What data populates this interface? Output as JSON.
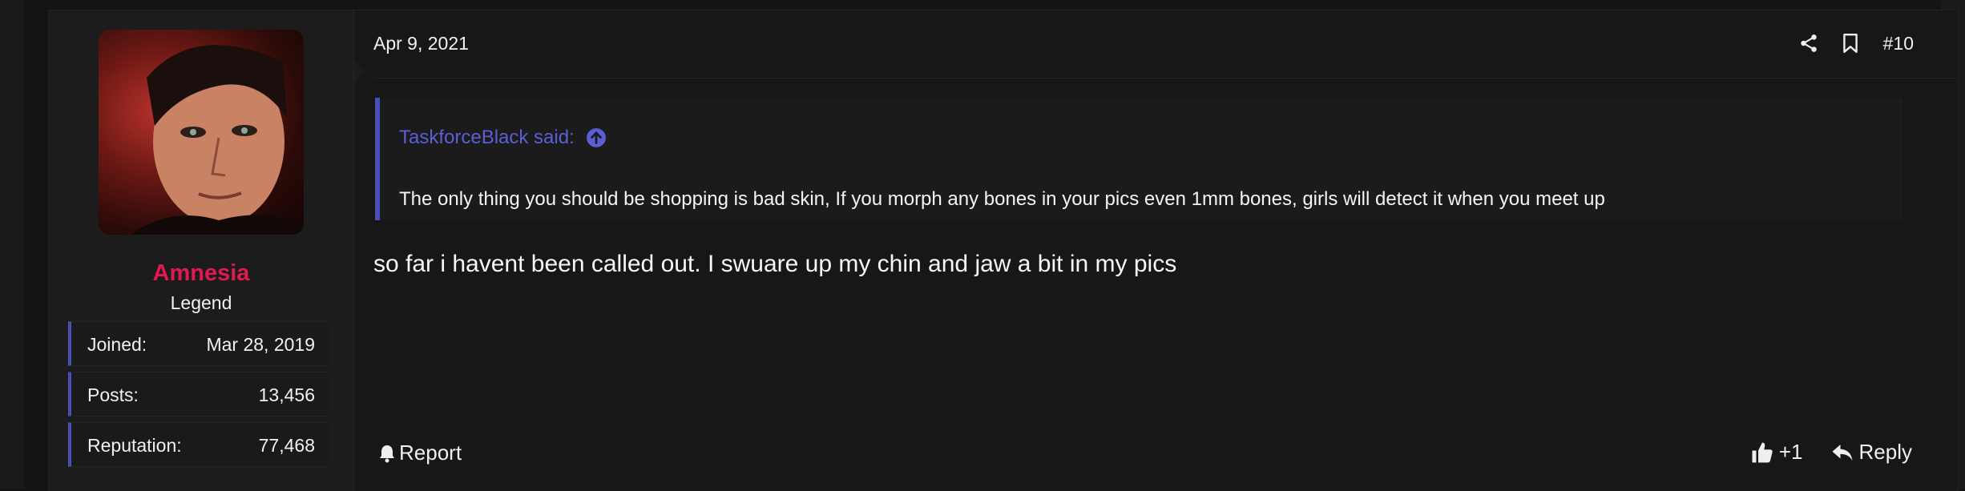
{
  "post": {
    "user": {
      "name": "Amnesia",
      "title": "Legend",
      "name_color": "#e0194f",
      "stats": [
        {
          "label": "Joined:",
          "value": "Mar 28, 2019"
        },
        {
          "label": "Posts:",
          "value": "13,456"
        },
        {
          "label": "Reputation:",
          "value": "77,468"
        }
      ]
    },
    "date": "Apr 9, 2021",
    "number": "#10",
    "header_icons": [
      "share-icon",
      "bookmark-icon"
    ],
    "quote": {
      "author": "TaskforceBlack said:",
      "icon": "arrow-up-circle-icon",
      "text": "The only thing you should be shopping is bad skin, If you morph any bones in your pics even 1mm bones, girls will detect it when you meet up"
    },
    "message": "so far i havent been called out. I swuare up my chin and jaw a bit in my pics",
    "actions": {
      "report": "Report",
      "like_count": "+1",
      "reply": "Reply"
    },
    "colors": {
      "accent": "#4a4fb8",
      "quote_link": "#5a5fd6",
      "background": "#171717"
    }
  }
}
